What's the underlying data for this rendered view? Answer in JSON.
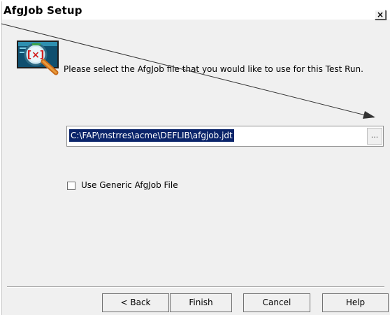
{
  "window": {
    "title": "AfgJob Setup",
    "close_glyph": "×"
  },
  "header": {
    "icon": "afgjob-search-icon",
    "instruction": "Please select the AfgJob file that you would like to use for this Test Run."
  },
  "file_selection": {
    "path_value": "C:\\FAP\\mstrres\\acme\\DEFLIB\\afgjob.jdt",
    "browse_label": "..."
  },
  "options": {
    "use_generic_label": "Use Generic AfgJob File",
    "use_generic_checked": false
  },
  "buttons": {
    "back": "< Back",
    "finish": "Finish",
    "cancel": "Cancel",
    "help": "Help"
  },
  "colors": {
    "selection_highlight": "#0a246a",
    "dialog_background": "#f0f0f0"
  }
}
